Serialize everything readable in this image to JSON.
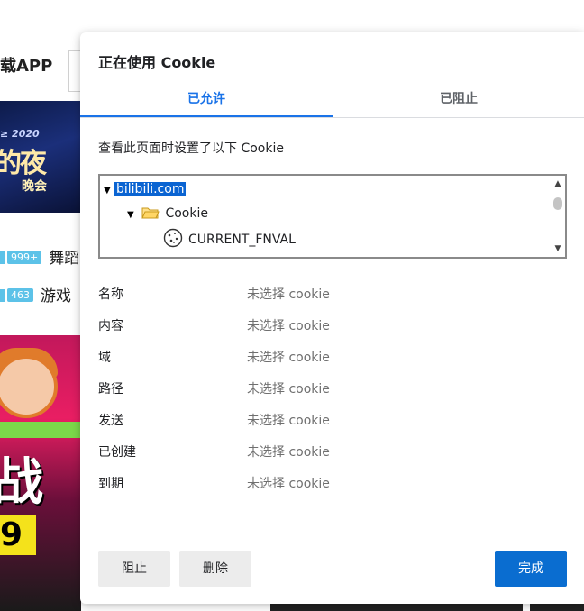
{
  "background": {
    "download_label": "载APP",
    "banner_line1": "≥ 2020",
    "banner_line2": "的夜",
    "banner_line3": "晚会",
    "row1_badge": "999+",
    "row1_text": "舞蹈",
    "row2_badge": "463",
    "row2_text": "游戏",
    "poster_big": "战",
    "poster_num": "9"
  },
  "dialog": {
    "title": "正在使用 Cookie",
    "tabs": [
      {
        "label": "已允许",
        "active": true
      },
      {
        "label": "已阻止",
        "active": false
      }
    ],
    "description": "查看此页面时设置了以下 Cookie",
    "tree": {
      "domain": "bilibili.com",
      "folder": "Cookie",
      "cookie": "CURRENT_FNVAL"
    },
    "properties": [
      {
        "key": "名称",
        "value": "未选择 cookie"
      },
      {
        "key": "内容",
        "value": "未选择 cookie"
      },
      {
        "key": "域",
        "value": "未选择 cookie"
      },
      {
        "key": "路径",
        "value": "未选择 cookie"
      },
      {
        "key": "发送",
        "value": "未选择 cookie"
      },
      {
        "key": "已创建",
        "value": "未选择 cookie"
      },
      {
        "key": "到期",
        "value": "未选择 cookie"
      }
    ],
    "buttons": {
      "block": "阻止",
      "delete": "删除",
      "done": "完成"
    }
  },
  "colors": {
    "accent": "#1a73e8",
    "primary_button": "#0a6dd0",
    "selection": "#0a64d2"
  }
}
